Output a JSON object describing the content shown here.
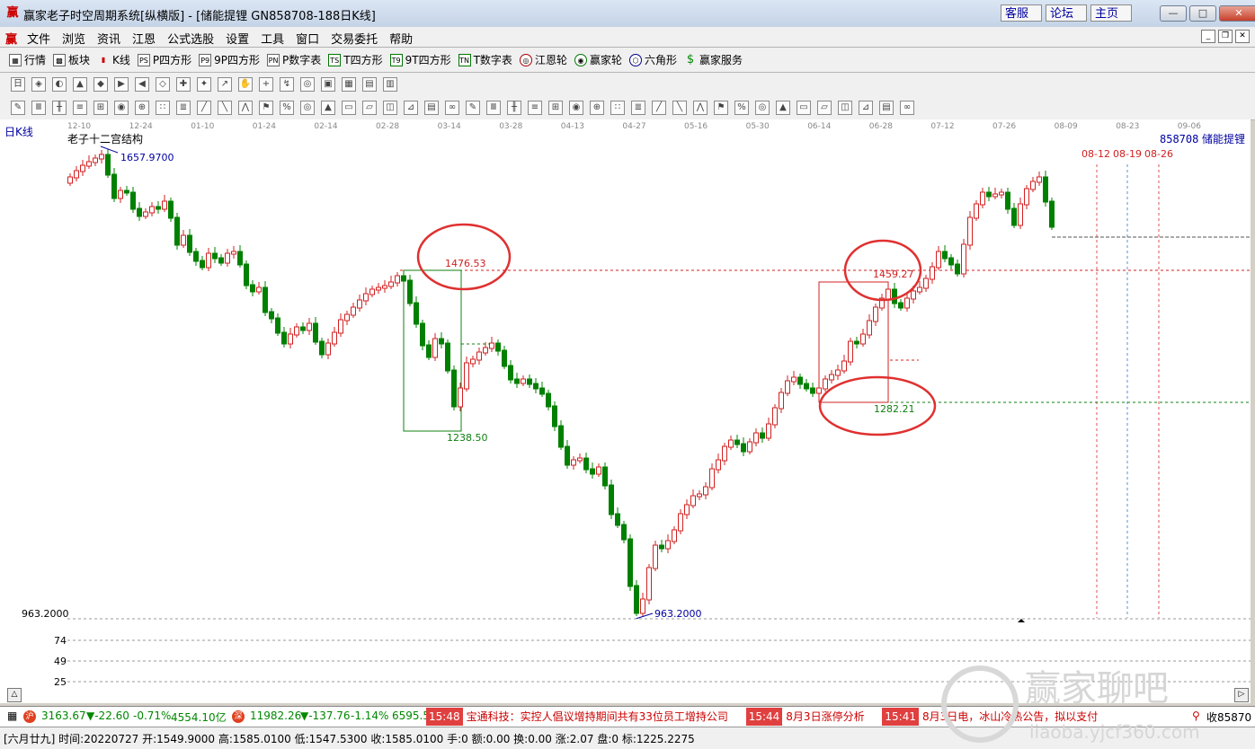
{
  "window": {
    "title": "赢家老子时空周期系统[纵横版] - [储能提锂  GN858708-188日K线]",
    "links": [
      "客服",
      "论坛",
      "主页"
    ],
    "controls": [
      "—",
      "□",
      "✕"
    ]
  },
  "menu": [
    "文件",
    "浏览",
    "资讯",
    "江恩",
    "公式选股",
    "设置",
    "工具",
    "窗口",
    "交易委托",
    "帮助"
  ],
  "toolbar_main": [
    {
      "label": "行情",
      "icon": "grid-icon"
    },
    {
      "label": "板块",
      "icon": "blocks-icon"
    },
    {
      "label": "K线",
      "icon": "candle-icon"
    },
    {
      "label": "P四方形",
      "icon": "ps-icon",
      "code": "PS"
    },
    {
      "label": "9P四方形",
      "icon": "p9-icon",
      "code": "P9"
    },
    {
      "label": "P数字表",
      "icon": "pn-icon",
      "code": "PN"
    },
    {
      "label": "T四方形",
      "icon": "ts-icon",
      "code": "TS"
    },
    {
      "label": "9T四方形",
      "icon": "t9-icon",
      "code": "T9"
    },
    {
      "label": "T数字表",
      "icon": "tn-icon",
      "code": "TN"
    },
    {
      "label": "江恩轮",
      "icon": "gann-wheel-icon"
    },
    {
      "label": "赢家轮",
      "icon": "winner-wheel-icon"
    },
    {
      "label": "六角形",
      "icon": "hexagon-icon"
    },
    {
      "label": "赢家服务",
      "icon": "dollar-icon"
    }
  ],
  "chart": {
    "period_label": "日K线",
    "structure_label": "老子十二宫结构",
    "stock_code": "858708",
    "stock_name": "储能提锂",
    "dates": [
      "12-10",
      "12-24",
      "01-10",
      "01-24",
      "02-14",
      "02-28",
      "03-14",
      "03-28",
      "04-13",
      "04-27",
      "05-16",
      "05-30",
      "06-14",
      "06-28",
      "07-12",
      "07-26",
      "08-09",
      "08-23",
      "09-06"
    ],
    "future_dates": [
      "08-12",
      "08-19",
      "08-26"
    ],
    "annotations": {
      "high": "1657.9700",
      "low": "963.2000",
      "box1_top": "1476.53",
      "box1_bottom": "1238.50",
      "box2_top": "1459.27",
      "box2_bottom": "1282.21"
    },
    "price_axis_label": "963.2000",
    "volume_ticks": [
      "74",
      "49",
      "25"
    ],
    "colors": {
      "up": "#d22020",
      "down": "#008000",
      "annotation_blue": "#0000a0",
      "circle": "#e03030"
    }
  },
  "bottombar": {
    "index1": {
      "value": "3163.67",
      "change": "▼-22.60",
      "pct": "-0.71%",
      "amount": "4554.10亿"
    },
    "index2": {
      "value": "11982.26",
      "change": "▼-137.76",
      "pct": "-1.14%",
      "amount": "6595.5"
    },
    "news": [
      {
        "time": "15:48",
        "text": "宝通科技：实控人倡议增持期间共有33位员工增持公司"
      },
      {
        "time": "15:44",
        "text": "8月3日涨停分析"
      },
      {
        "time": "15:41",
        "text": "8月3日电，冰山冷热公告，拟以支付"
      }
    ],
    "right_text": "收85870"
  },
  "status": "[六月廿九] 时间:20220727 开:1549.9000 高:1585.0100 低:1547.5300 收:1585.0100 手:0 额:0.00 换:0.00 涨:2.07 盘:0 标:1225.2275",
  "watermark": {
    "site": "赢家聊吧",
    "url": "liaoba.yjcf360.com"
  }
}
